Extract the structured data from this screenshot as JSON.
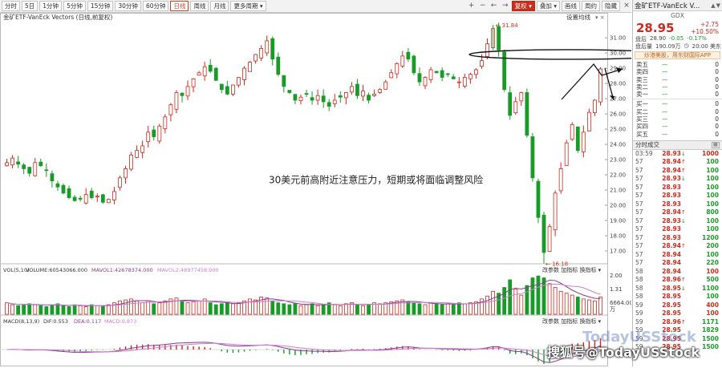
{
  "toolbar": {
    "periods": [
      "分时",
      "5日",
      "1分钟",
      "5分钟",
      "15分钟",
      "30分钟",
      "60分钟",
      "日线",
      "周线",
      "月线",
      "更多周期"
    ],
    "active": "日线",
    "right_buttons": [
      "复权",
      "叠加",
      "画线",
      "周约",
      "隐藏"
    ],
    "icons": [
      "plus-icon",
      "minus-icon",
      "left-icon",
      "right-icon"
    ]
  },
  "chart": {
    "title": "金矿ETF-VanEck Vectors (日线,前复权)",
    "settings_label": "设置均线",
    "annotation": "30美元前高附近注意压力，短期或将面临调整风险",
    "high_label": "31.84",
    "low_label": "16.18",
    "price_axis": [
      "31.00",
      "30.00",
      "29.00",
      "28.00",
      "27.00",
      "26.00",
      "25.00",
      "24.00",
      "23.00",
      "22.00",
      "21.00",
      "20.00",
      "19.00",
      "18.00",
      "17.00"
    ],
    "vol_legend": [
      "VOL(5,10)",
      "VOLUME:60543066.000",
      "MAVOL1:42678374.000",
      "MAVOL2:48977458.900"
    ],
    "vol_axis": [
      "2.00",
      "1.31",
      "6664.00",
      "万"
    ],
    "macd_legend": [
      "MACD(8,13,9)",
      "DIF:0.553",
      "DEA:0.117",
      "MACD:0.873"
    ],
    "sub_buttons": [
      "改参数",
      "加指标",
      "换指标"
    ],
    "colors": {
      "up": "#d0291b",
      "down": "#199b28",
      "ma1": "#8a3a8f",
      "ma2": "#c97fd0"
    }
  },
  "chart_data": {
    "type": "candlestick",
    "title": "金矿ETF-VanEck Vectors (日线,前复权)",
    "xlabel": "",
    "ylabel": "",
    "ylim": [
      16.0,
      31.9
    ],
    "high": 31.84,
    "low": 16.18,
    "close_series": [
      22.8,
      23.1,
      22.7,
      22.4,
      22.1,
      22.8,
      22.6,
      22.3,
      21.6,
      21.2,
      20.8,
      20.5,
      20.3,
      20.4,
      20.7,
      20.5,
      20.6,
      20.2,
      20.4,
      20.9,
      21.8,
      22.4,
      23.3,
      23.6,
      23.9,
      24.8,
      24.5,
      25.2,
      25.8,
      26.6,
      27.4,
      27.2,
      27.8,
      28.3,
      28.7,
      29.1,
      28.8,
      28.2,
      27.6,
      27.3,
      27.9,
      28.4,
      29.0,
      29.4,
      29.9,
      30.3,
      30.8,
      29.6,
      28.6,
      27.8,
      27.4,
      26.9,
      27.1,
      27.3,
      26.9,
      27.2,
      26.8,
      26.5,
      26.9,
      27.1,
      27.4,
      27.8,
      27.2,
      27.5,
      26.9,
      27.3,
      27.6,
      28.1,
      28.7,
      29.3,
      29.8,
      29.6,
      28.7,
      28.1,
      28.4,
      28.9,
      28.7,
      28.4,
      28.6,
      28.3,
      28.1,
      28.4,
      28.6,
      28.9,
      29.5,
      30.6,
      31.6,
      30.2,
      27.6,
      25.9,
      26.8,
      27.4,
      24.6,
      21.8,
      19.2,
      16.9,
      18.6,
      20.8,
      22.4,
      24.1,
      25.3,
      23.6,
      24.8,
      26.1,
      26.9,
      28.95
    ],
    "vol_series": [
      0.6,
      0.5,
      0.45,
      0.5,
      0.55,
      0.5,
      0.45,
      0.4,
      0.5,
      0.55,
      0.45,
      0.4,
      0.5,
      0.45,
      0.4,
      0.5,
      0.45,
      0.4,
      0.5,
      0.6,
      0.7,
      0.75,
      0.8,
      0.7,
      0.6,
      0.7,
      0.55,
      0.6,
      0.7,
      0.8,
      0.85,
      0.7,
      0.6,
      0.65,
      0.7,
      0.8,
      0.6,
      0.5,
      0.55,
      0.6,
      0.55,
      0.6,
      0.7,
      0.8,
      0.75,
      0.9,
      0.85,
      0.7,
      0.6,
      0.55,
      0.5,
      0.55,
      0.45,
      0.5,
      0.55,
      0.45,
      0.5,
      0.6,
      0.5,
      0.45,
      0.55,
      0.6,
      0.5,
      0.45,
      0.5,
      0.6,
      0.55,
      0.6,
      0.65,
      0.7,
      0.75,
      0.65,
      0.6,
      0.55,
      0.5,
      0.6,
      0.55,
      0.5,
      0.55,
      0.5,
      0.6,
      0.55,
      0.6,
      0.65,
      0.8,
      0.95,
      1.2,
      1.1,
      1.4,
      1.8,
      1.3,
      1.0,
      1.5,
      1.9,
      2.0,
      1.9,
      1.6,
      1.4,
      1.2,
      1.1,
      1.0,
      0.9,
      0.8,
      0.75,
      0.7,
      0.9
    ]
  },
  "panel": {
    "name": "金矿ETF-VanEck V...",
    "code": "GDX",
    "price": "28.95",
    "change": "+2.75",
    "pct": "+10.50%",
    "prev_close_label": "盘后",
    "prev_close": "28.90",
    "prev_chg": "-0.05",
    "prev_pct": "-0.17%",
    "vol_label": "盘后量",
    "vol": "190.09万",
    "time": "20:00 美东",
    "ad": "炒港美股，用东财国际APP",
    "asks": [
      {
        "label": "卖五",
        "price": "—",
        "qty": "0"
      },
      {
        "label": "卖四",
        "price": "—",
        "qty": "0"
      },
      {
        "label": "卖三",
        "price": "—",
        "qty": "0"
      },
      {
        "label": "卖二",
        "price": "—",
        "qty": "0"
      },
      {
        "label": "卖一",
        "price": "—",
        "qty": "0"
      }
    ],
    "bids": [
      {
        "label": "买一",
        "price": "—",
        "qty": "0"
      },
      {
        "label": "买二",
        "price": "—",
        "qty": "0"
      },
      {
        "label": "买三",
        "price": "—",
        "qty": "0"
      },
      {
        "label": "买四",
        "price": "—",
        "qty": "0"
      },
      {
        "label": "买五",
        "price": "—",
        "qty": "0"
      }
    ],
    "tape_title": "分时成交",
    "tape": [
      {
        "t": "03:59",
        "p": "28.93",
        "d": "dn",
        "v": "1000",
        "vc": "n"
      },
      {
        "t": "57",
        "p": "28.94",
        "d": "up",
        "v": "100",
        "vc": "dn"
      },
      {
        "t": "57",
        "p": "28.94",
        "d": "up",
        "v": "100",
        "vc": "dn"
      },
      {
        "t": "57",
        "p": "28.93",
        "d": "dn",
        "v": "100",
        "vc": "dn"
      },
      {
        "t": "57",
        "p": "28.93",
        "d": "",
        "v": "100",
        "vc": "dn"
      },
      {
        "t": "57",
        "p": "28.93",
        "d": "",
        "v": "100",
        "vc": "dn"
      },
      {
        "t": "57",
        "p": "28.93",
        "d": "",
        "v": "100",
        "vc": "dn"
      },
      {
        "t": "57",
        "p": "28.94",
        "d": "up",
        "v": "800",
        "vc": "dn"
      },
      {
        "t": "57",
        "p": "28.93",
        "d": "dn",
        "v": "100",
        "vc": "dn"
      },
      {
        "t": "57",
        "p": "28.93",
        "d": "",
        "v": "100",
        "vc": "dn"
      },
      {
        "t": "57",
        "p": "28.93",
        "d": "",
        "v": "1200",
        "vc": "dn"
      },
      {
        "t": "57",
        "p": "28.94",
        "d": "up",
        "v": "200",
        "vc": "dn"
      },
      {
        "t": "57",
        "p": "28.94",
        "d": "",
        "v": "100",
        "vc": "dn"
      },
      {
        "t": "57",
        "p": "28.94",
        "d": "",
        "v": "220",
        "vc": "dn"
      },
      {
        "t": "58",
        "p": "28.94",
        "d": "",
        "v": "100",
        "vc": "n"
      },
      {
        "t": "58",
        "p": "28.96",
        "d": "up",
        "v": "500",
        "vc": "dn"
      },
      {
        "t": "58",
        "p": "28.95",
        "d": "dn",
        "v": "1100",
        "vc": "dn"
      },
      {
        "t": "58",
        "p": "28.95",
        "d": "",
        "v": "100",
        "vc": "dn"
      },
      {
        "t": "59",
        "p": "28.95",
        "d": "",
        "v": "400",
        "vc": "n"
      },
      {
        "t": "59",
        "p": "28.95",
        "d": "",
        "v": "100",
        "vc": "n"
      },
      {
        "t": "59",
        "p": "28.96",
        "d": "up",
        "v": "1171",
        "vc": "dn"
      },
      {
        "t": "59",
        "p": "28.95",
        "d": "",
        "v": "1829",
        "vc": "dn"
      },
      {
        "t": "59",
        "p": "28.95",
        "d": "",
        "v": "1500",
        "vc": "dn"
      },
      {
        "t": "59",
        "p": "28.95",
        "d": "",
        "v": "1500",
        "vc": "dn"
      }
    ]
  },
  "watermark": "搜狐号@TodayUSStock",
  "watermark_faint": "TodayUSStock"
}
